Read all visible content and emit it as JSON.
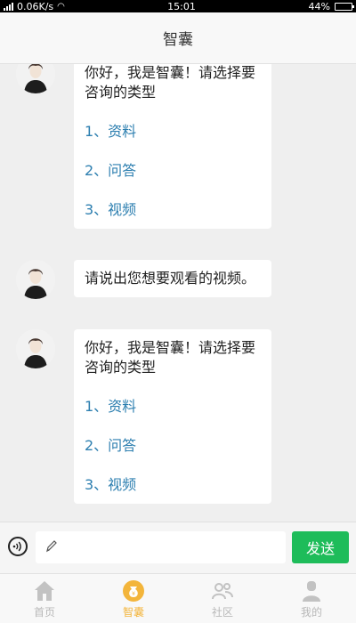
{
  "status_bar": {
    "speed": "0.06K/s",
    "time": "15:01",
    "battery": "44%",
    "battery_level": 0.44
  },
  "header": {
    "title": "智囊"
  },
  "chat": {
    "messages": [
      {
        "text": "你好，我是智囊！请选择要咨询的类型",
        "options": [
          "1、资料",
          "2、问答",
          "3、视频"
        ]
      },
      {
        "text": "请说出您想要观看的视频。"
      },
      {
        "text": "你好，我是智囊！请选择要咨询的类型",
        "options": [
          "1、资料",
          "2、问答",
          "3、视频"
        ]
      }
    ]
  },
  "input_bar": {
    "placeholder": "",
    "send_label": "发送",
    "voice_icon": "voice-icon",
    "edit_icon": "pencil-icon"
  },
  "tab_bar": {
    "tabs": [
      {
        "label": "首页",
        "icon": "home-icon"
      },
      {
        "label": "智囊",
        "icon": "wisdom-bag-icon",
        "active": true
      },
      {
        "label": "社区",
        "icon": "community-icon"
      },
      {
        "label": "我的",
        "icon": "profile-icon"
      }
    ]
  },
  "colors": {
    "accent_green": "#1ebc5a",
    "active_tab": "#f3b53b",
    "link_blue": "#2d7fb0"
  }
}
